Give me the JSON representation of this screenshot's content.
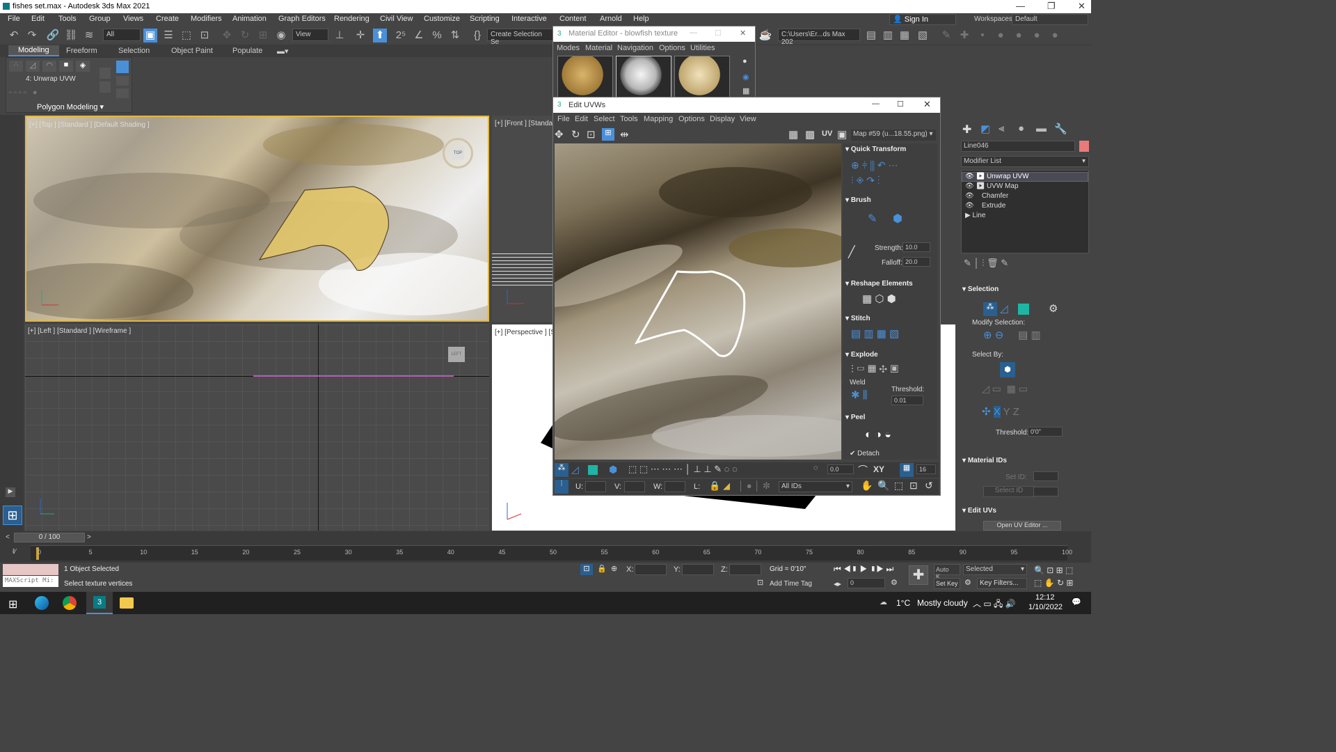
{
  "window": {
    "title": "fishes set.max - Autodesk 3ds Max 2021"
  },
  "menu": [
    "File",
    "Edit",
    "Tools",
    "Group",
    "Views",
    "Create",
    "Modifiers",
    "Animation",
    "Graph Editors",
    "Rendering",
    "Civil View",
    "Customize",
    "Scripting",
    "Interactive",
    "Content",
    "Arnold",
    "Help"
  ],
  "account": {
    "sign_in": "Sign In",
    "workspaces_label": "Workspaces:",
    "workspace": "Default"
  },
  "toolbar": {
    "filter": "All",
    "view": "View",
    "create_selection": "Create Selection Se",
    "path": "C:\\Users\\Er...ds Max 202"
  },
  "ribbon": {
    "tabs": [
      "Modeling",
      "Freeform",
      "Selection",
      "Object Paint",
      "Populate"
    ],
    "modifier": "4: Unwrap UVW",
    "group": "Polygon Modeling"
  },
  "viewports": {
    "top": "[+] [Top ] [Standard ] [Default Shading ]",
    "front": "[+] [Front ] [Standa",
    "left": "[+] [Left ] [Standard ] [Wireframe ]",
    "perspective": "[+] [Perspective ] [S",
    "viewcube_top": "TOP",
    "viewcube_left": "LEFT"
  },
  "material_editor": {
    "title": "Material Editor - blowfish texture",
    "menu": [
      "Modes",
      "Material",
      "Navigation",
      "Options",
      "Utilities"
    ]
  },
  "edit_uvws": {
    "title": "Edit UVWs",
    "menu": [
      "File",
      "Edit",
      "Select",
      "Tools",
      "Mapping",
      "Options",
      "Display",
      "View"
    ],
    "uv_label": "UV",
    "map": "Map #59 (u...18.55.png)",
    "quick_transform": "Quick Transform",
    "brush": "Brush",
    "strength_label": "Strength:",
    "strength": "10.0",
    "falloff_label": "Falloff:",
    "falloff": "20.0",
    "reshape": "Reshape Elements",
    "stitch": "Stitch",
    "explode": "Explode",
    "weld": "Weld",
    "threshold_label": "Threshold:",
    "threshold": "0.01",
    "peel": "Peel",
    "detach": "Detach",
    "angle": "0.0",
    "xy": "XY",
    "grid_value": "16",
    "u_label": "U:",
    "v_label": "V:",
    "w_label": "W:",
    "l_label": "L:",
    "ids": "All IDs"
  },
  "command_panel": {
    "object_name": "Line046",
    "modifier_list": "Modifier List",
    "stack": [
      "Unwrap UVW",
      "UVW Map",
      "Chamfer",
      "Extrude",
      "Line"
    ],
    "selection": "Selection",
    "modify_selection": "Modify Selection:",
    "select_by": "Select By:",
    "threshold_label": "Threshold:",
    "threshold": "0'0\"",
    "material_ids": "Material IDs",
    "set_id": "Set ID:",
    "select_id": "Select ID",
    "edit_uvs": "Edit UVs",
    "open_uv_editor": "Open UV Editor ..."
  },
  "timeline": {
    "frame": "0 / 100",
    "ticks": [
      "0",
      "5",
      "10",
      "15",
      "20",
      "25",
      "30",
      "35",
      "40",
      "45",
      "50",
      "55",
      "60",
      "65",
      "70",
      "75",
      "80",
      "85",
      "90",
      "95",
      "100"
    ]
  },
  "status": {
    "script": "MAXScript Mi:",
    "selected": "1 Object Selected",
    "hint": "Select texture vertices",
    "x_label": "X:",
    "y_label": "Y:",
    "z_label": "Z:",
    "grid": "Grid = 0'10\"",
    "add_time_tag": "Add Time Tag",
    "auto_key": "Auto K...",
    "set_key": "Set Key",
    "key_mode": "Selected",
    "key_filters": "Key Filters...",
    "frame_field": "0"
  },
  "taskbar": {
    "weather_temp": "1°C",
    "weather": "Mostly cloudy",
    "time": "12:12",
    "date": "1/10/2022"
  }
}
